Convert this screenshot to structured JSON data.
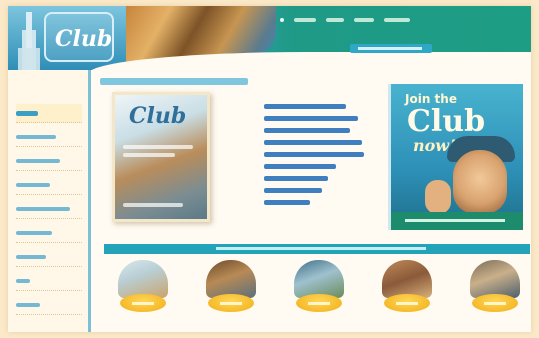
{
  "header": {
    "logo_text": "Club",
    "nav_links": [
      "",
      "",
      "",
      ""
    ],
    "search": ""
  },
  "sidebar": {
    "items": [
      {
        "label": "",
        "active": true
      },
      {
        "label": ""
      },
      {
        "label": ""
      },
      {
        "label": ""
      },
      {
        "label": ""
      },
      {
        "label": ""
      },
      {
        "label": ""
      },
      {
        "label": ""
      },
      {
        "label": ""
      }
    ]
  },
  "main": {
    "magazine_title": "Club",
    "links": [
      "",
      "",
      "",
      "",
      "",
      "",
      "",
      "",
      ""
    ],
    "promo": {
      "line1": "Join the",
      "line2": "Club",
      "line3": "now!"
    },
    "section_title": "",
    "tiles": [
      "",
      "",
      "",
      "",
      ""
    ]
  },
  "colors": {
    "header_teal": "#1d9d84",
    "accent_blue": "#2f8fb9",
    "page_bg": "#fbe9c9",
    "pill_yellow": "#f5ba2a",
    "link_blue": "#3f7fc0"
  },
  "icons": [
    "tower-icon"
  ]
}
